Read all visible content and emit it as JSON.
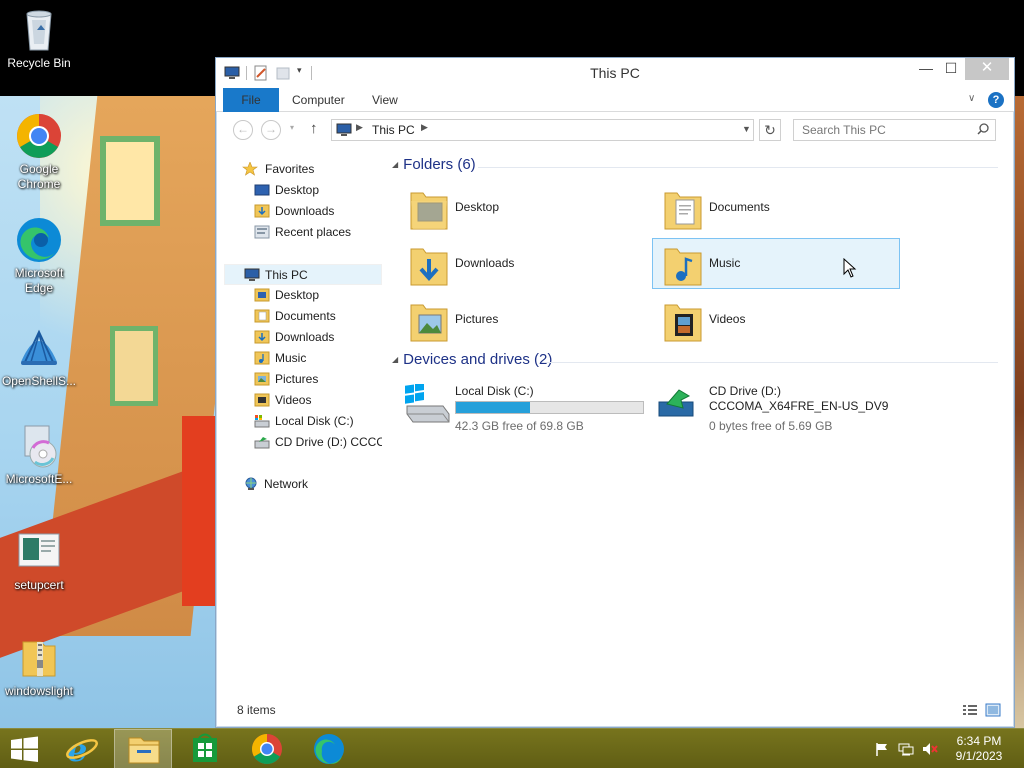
{
  "desktop": {
    "icons": [
      {
        "label": "Recycle Bin",
        "icon": "recycle-bin-icon"
      },
      {
        "label": "Google Chrome",
        "icon": "chrome-icon"
      },
      {
        "label": "Microsoft Edge",
        "icon": "edge-icon"
      },
      {
        "label": "OpenShellS...",
        "icon": "openshell-icon"
      },
      {
        "label": "MicrosoftE...",
        "icon": "installer-icon"
      },
      {
        "label": "setupcert",
        "icon": "file-icon"
      },
      {
        "label": "windowslight",
        "icon": "zip-folder-icon"
      }
    ]
  },
  "window": {
    "title": "This PC",
    "ribbon": {
      "file": "File",
      "computer": "Computer",
      "view": "View"
    },
    "address": {
      "path": "This PC"
    },
    "search": {
      "placeholder": "Search This PC"
    },
    "nav": {
      "favorites": "Favorites",
      "favorites_items": [
        "Desktop",
        "Downloads",
        "Recent places"
      ],
      "this_pc": "This PC",
      "this_pc_items": [
        "Desktop",
        "Documents",
        "Downloads",
        "Music",
        "Pictures",
        "Videos",
        "Local Disk (C:)",
        "CD Drive (D:) CCCOI"
      ],
      "network": "Network"
    },
    "folders_header": "Folders (6)",
    "folders": [
      "Desktop",
      "Documents",
      "Downloads",
      "Music",
      "Pictures",
      "Videos"
    ],
    "hovered_folder": "Music",
    "drives_header": "Devices and drives (2)",
    "drives": [
      {
        "name": "Local Disk (C:)",
        "free": "42.3 GB free of 69.8 GB",
        "used_fraction": 0.394
      },
      {
        "name": "CD Drive (D:)",
        "label": "CCCOMA_X64FRE_EN-US_DV9",
        "free": "0 bytes free of 5.69 GB"
      }
    ],
    "status": "8 items",
    "colors": {
      "accent": "#1979ca",
      "group_header": "#1e3287",
      "drive_bar": "#26a0da",
      "hover": "#e5f3fb"
    }
  },
  "taskbar": {
    "pinned": [
      "start-icon",
      "internet-explorer-icon",
      "file-explorer-icon",
      "store-icon",
      "chrome-icon",
      "edge-icon"
    ],
    "active": "file-explorer-icon",
    "time": "6:34 PM",
    "date": "9/1/2023"
  }
}
